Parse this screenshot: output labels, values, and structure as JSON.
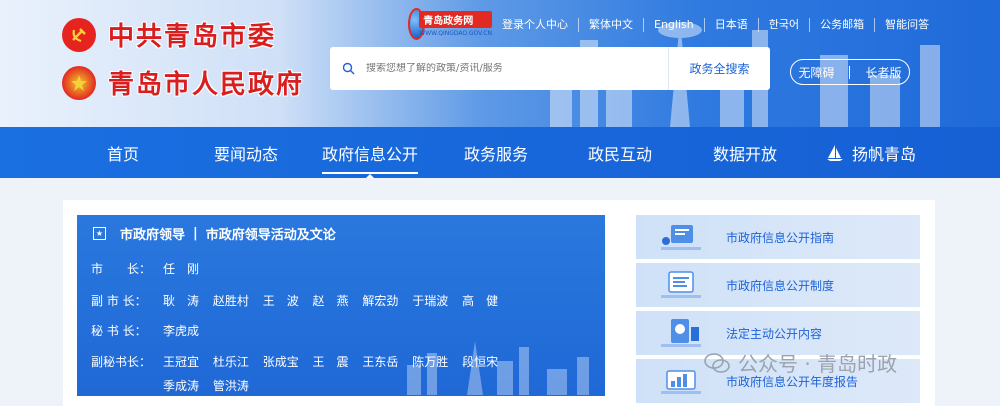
{
  "brand": {
    "party_title": "中共青岛市委",
    "gov_title": "青岛市人民政府",
    "badge_name": "青岛政务网",
    "badge_url": "WWW.QINGDAO.GOV.CN"
  },
  "top_links": [
    "登录个人中心",
    "繁体中文",
    "English",
    "日本语",
    "한국어",
    "公务邮箱",
    "智能问答"
  ],
  "search": {
    "placeholder": "搜索您想了解的政策/资讯/服务",
    "button_label": "政务全搜索"
  },
  "accessibility": {
    "barrier_free": "无障碍",
    "elderly": "长者版"
  },
  "nav": {
    "items": [
      "首页",
      "要闻动态",
      "政府信息公开",
      "政务服务",
      "政民互动",
      "数据开放",
      "扬帆青岛"
    ],
    "active": "政府信息公开"
  },
  "leaders": {
    "title_main": "市政府领导",
    "divider": "|",
    "title_sub": "市政府领导活动及文论",
    "mayor_role": "市　　长：",
    "mayor_names": [
      "任　刚"
    ],
    "vice_role": "副 市 长：",
    "vice_names": [
      "耿　涛",
      "赵胜村",
      "王　波",
      "赵　燕",
      "解宏劲",
      "于瑞波",
      "高　健"
    ],
    "secgen_role": "秘 书 长：",
    "secgen_names": [
      "李虎成"
    ],
    "deputy_role": "副秘书长：",
    "deputy_names_line1": [
      "王冠宜",
      "杜乐江",
      "张成宝",
      "王　震",
      "王东岳",
      "陈万胜",
      "段恒宋"
    ],
    "deputy_names_line2": [
      "季成涛",
      "管洪涛"
    ]
  },
  "info_links": [
    "市政府信息公开指南",
    "市政府信息公开制度",
    "法定主动公开内容",
    "市政府信息公开年度报告"
  ],
  "watermark": "公众号 · 青岛时政",
  "colors": {
    "primary_blue": "#1d63d6",
    "nav_blue": "#1a6fe1",
    "brand_red": "#d81e1e"
  }
}
